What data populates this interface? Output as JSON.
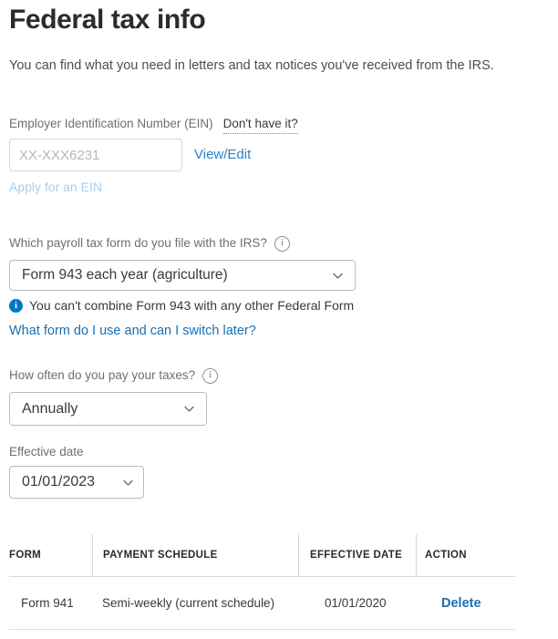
{
  "header": {
    "title": "Federal tax info",
    "subtitle": "You can find what you need in letters and tax notices you've received from the IRS."
  },
  "ein": {
    "label": "Employer Identification Number (EIN)",
    "help_link": "Don't have it?",
    "value": "",
    "placeholder": "XX-XXX6231",
    "view_edit_link": "View/Edit",
    "apply_link": "Apply for an EIN"
  },
  "payroll_form": {
    "label": "Which payroll tax form do you file with the IRS?",
    "info_icon": "info-circle-outline-icon",
    "selected": "Form 943 each year (agriculture)",
    "note_icon": "info-circle-filled-icon",
    "note": "You can't combine Form 943 with any other Federal Form",
    "help_link": "What form do I use and can I switch later?"
  },
  "frequency": {
    "label": "How often do you pay your taxes?",
    "info_icon": "info-circle-outline-icon",
    "selected": "Annually"
  },
  "effective_date": {
    "label": "Effective date",
    "selected": "01/01/2023"
  },
  "table": {
    "columns": [
      "FORM",
      "PAYMENT SCHEDULE",
      "EFFECTIVE DATE",
      "ACTION"
    ],
    "rows": [
      {
        "form": "Form 941",
        "payment_schedule": "Semi-weekly (current schedule)",
        "effective_date": "01/01/2020",
        "action": "Delete"
      }
    ]
  },
  "colors": {
    "link_blue": "#1b6fb0",
    "link_blue_light": "#2f80c2",
    "link_disabled": "#a8cdea",
    "info_blue": "#0077c5",
    "text_dark": "#393a3d",
    "text_muted": "#6b6f76",
    "border": "#d4d7dc"
  }
}
